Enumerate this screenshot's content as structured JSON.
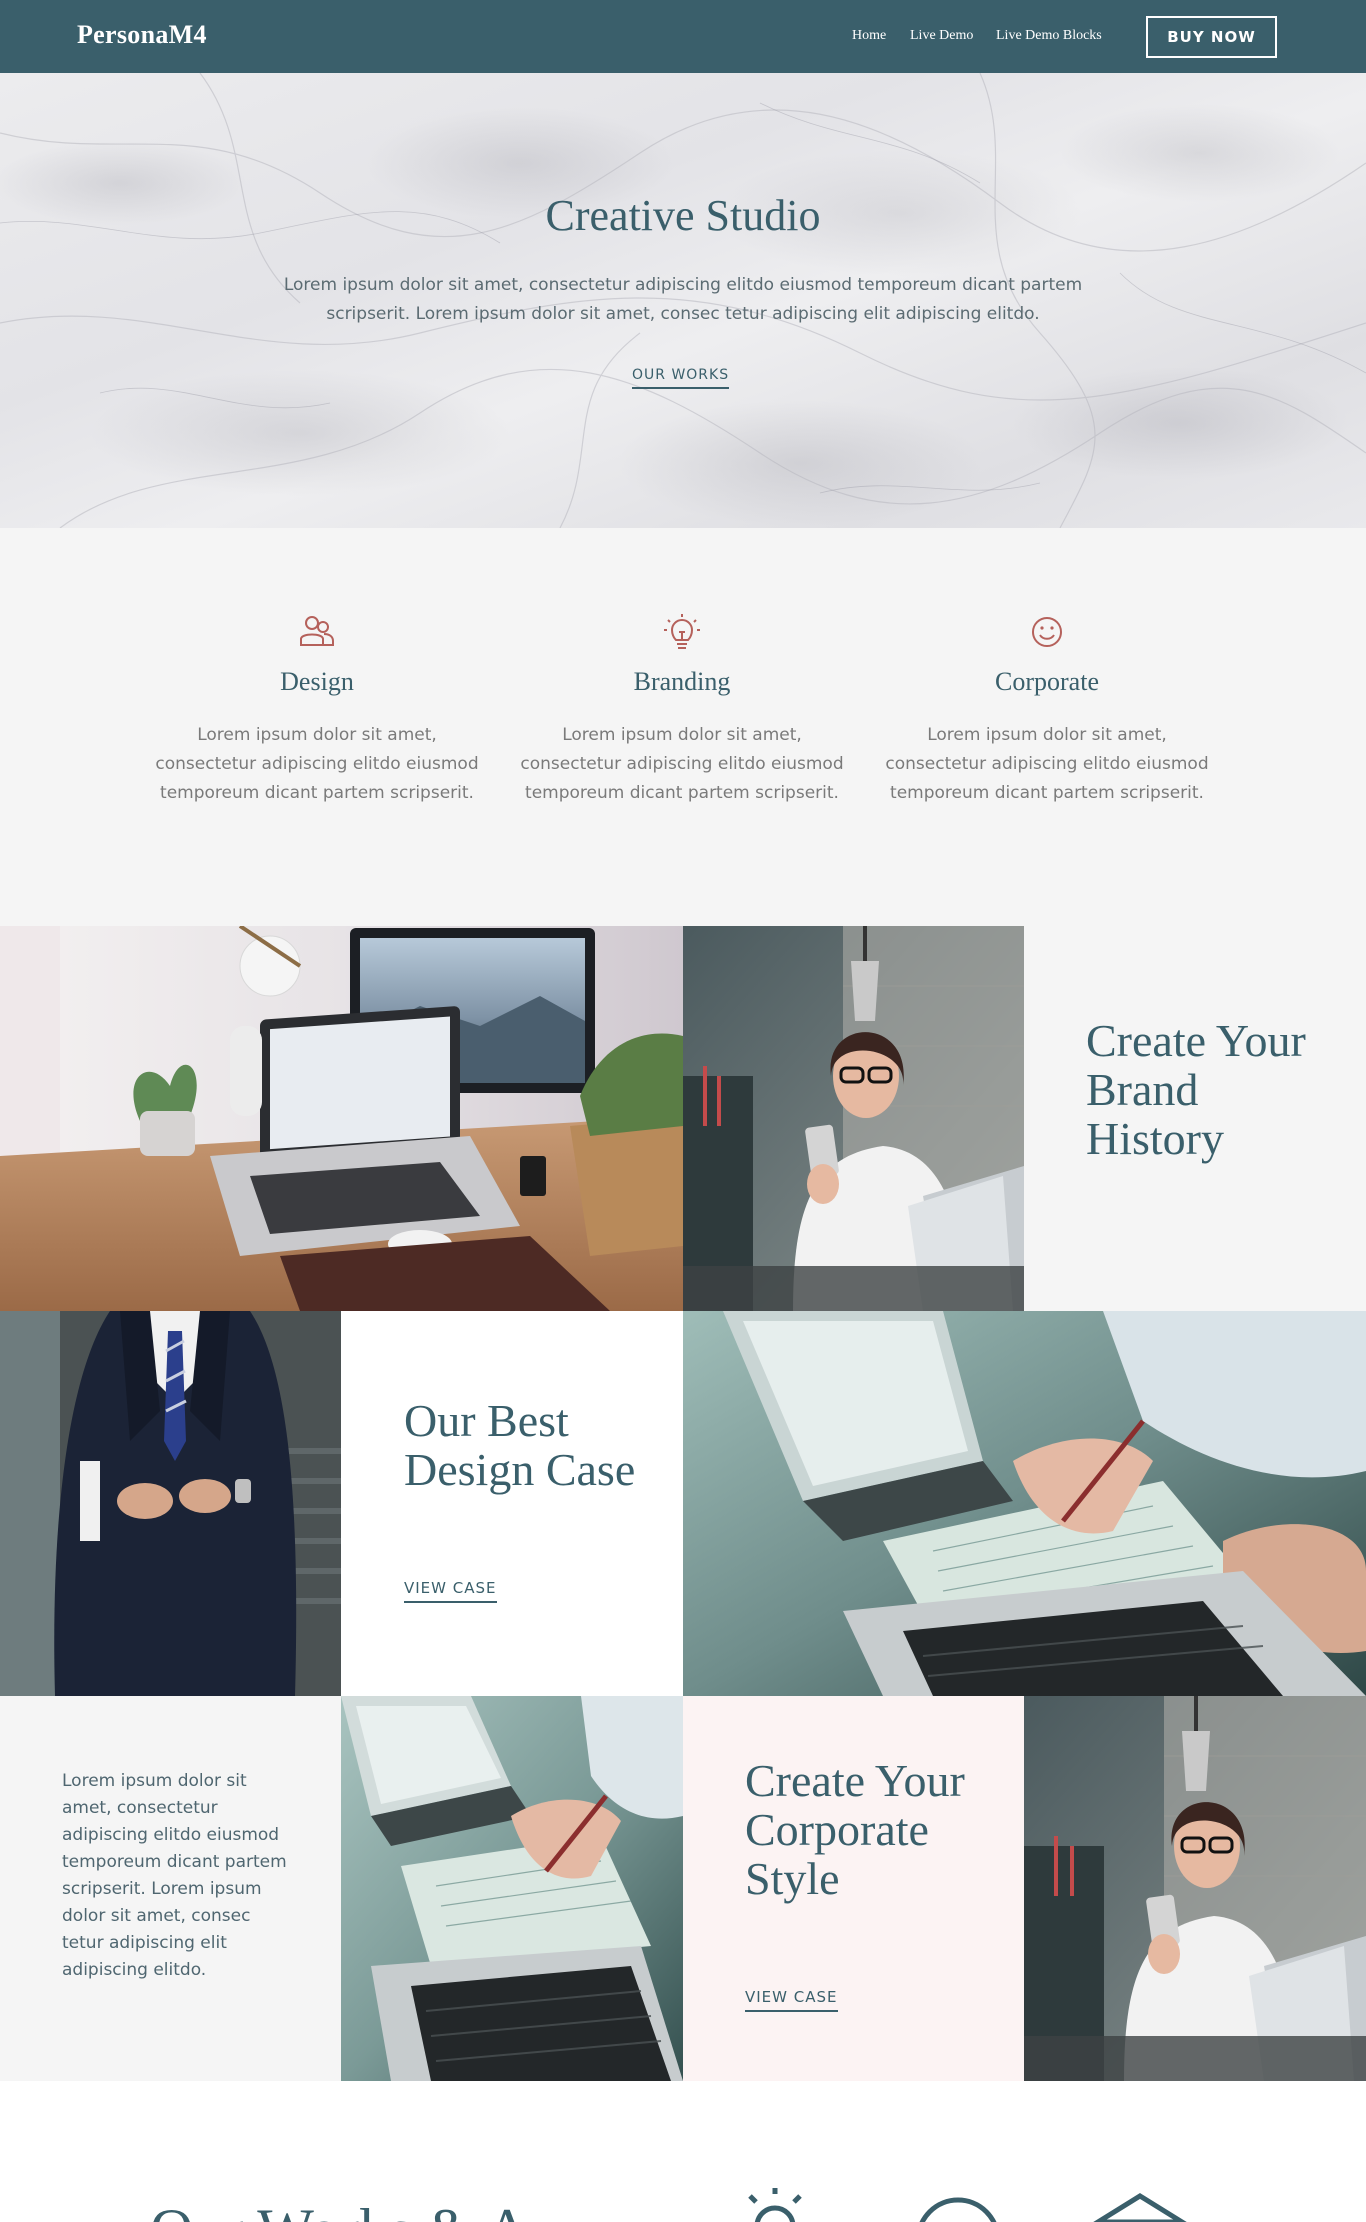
{
  "navbar": {
    "brand": "PersonaM4",
    "links": [
      "Home",
      "Live Demo",
      "Live Demo Blocks"
    ],
    "buy_label": "BUY NOW"
  },
  "hero": {
    "title": "Creative Studio",
    "text": "Lorem ipsum dolor sit amet, consectetur adipiscing elitdo eiusmod temporeum dicant partem scripserit. Lorem ipsum dolor sit amet, consec tetur adipiscing elit adipiscing elitdo.",
    "link_label": "OUR WORKS"
  },
  "features": [
    {
      "icon": "users-icon",
      "title": "Design",
      "text": "Lorem ipsum dolor sit amet, consectetur adipiscing elitdo eiusmod temporeum dicant partem scripserit."
    },
    {
      "icon": "lightbulb-icon",
      "title": "Branding",
      "text": "Lorem ipsum dolor sit amet, consectetur adipiscing elitdo eiusmod temporeum dicant partem scripserit."
    },
    {
      "icon": "smiley-icon",
      "title": "Corporate",
      "text": "Lorem ipsum dolor sit amet, consectetur adipiscing elitdo eiusmod temporeum dicant partem scripserit."
    }
  ],
  "grid": {
    "brand_history": "Create Your Brand History",
    "best_design": "Our Best Design Case",
    "best_design_link": "VIEW CASE",
    "paragraph": "Lorem ipsum dolor sit amet, consectetur adipiscing elitdo eiusmod temporeum dicant partem scripserit. Lorem ipsum dolor sit amet, consec tetur adipiscing elit adipiscing elitdo.",
    "corporate_style": "Create Your Corporate Style",
    "corporate_style_link": "VIEW CASE"
  },
  "bottom": {
    "heading_partial": "Our Works & A"
  },
  "colors": {
    "primary": "#3a5f6b",
    "accent_icon": "#b5615b",
    "section_bg": "#f5f5f5",
    "pink_bg": "#fcf3f3"
  }
}
